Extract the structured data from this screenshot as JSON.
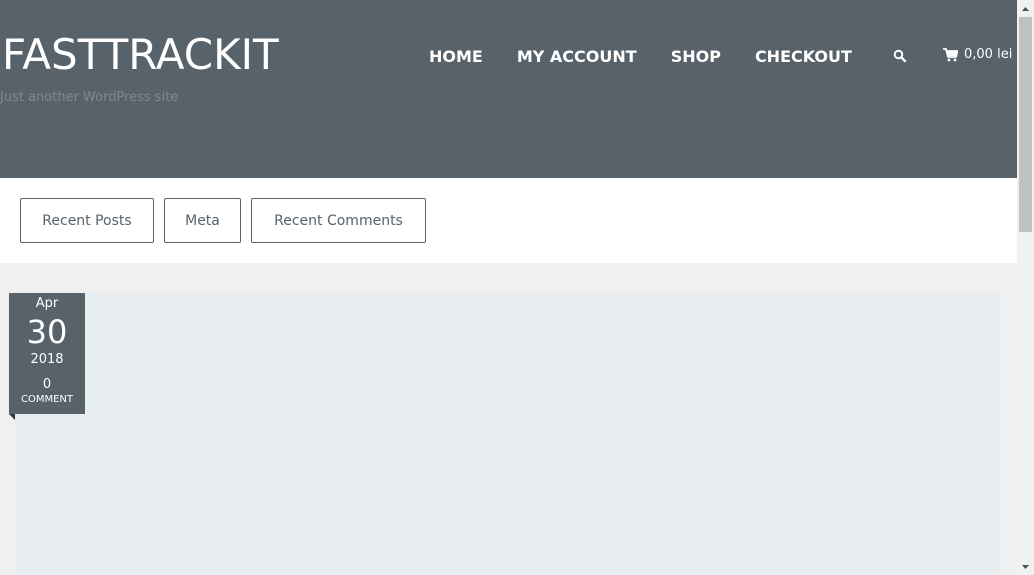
{
  "header": {
    "site_title": "FASTTRACKIT",
    "tagline": "Just another WordPress site",
    "nav": [
      "HOME",
      "MY ACCOUNT",
      "SHOP",
      "CHECKOUT"
    ],
    "search_icon": "search-icon",
    "cart_icon": "cart-icon",
    "cart_total": "0,00 lei"
  },
  "widget_tabs": [
    "Recent Posts",
    "Meta",
    "Recent Comments"
  ],
  "post": {
    "month": "Apr",
    "day": "30",
    "year": "2018",
    "comment_count": "0",
    "comment_label": "COMMENT"
  },
  "colors": {
    "header_bg": "#57626a",
    "card_bg": "#e8edf2",
    "page_bg": "#f0f0f0"
  }
}
